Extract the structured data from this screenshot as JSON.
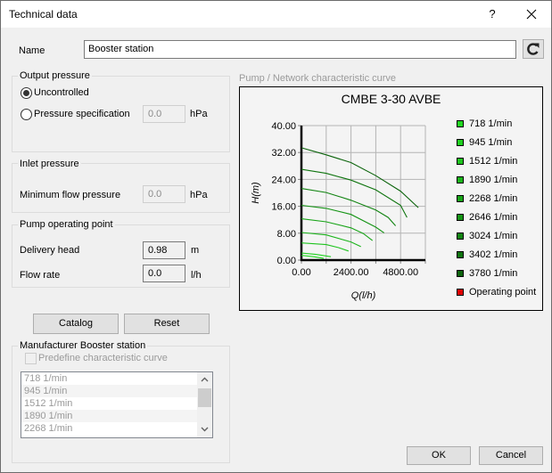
{
  "window": {
    "title": "Technical data",
    "help_label": "?",
    "close_label": "✕"
  },
  "name_field": {
    "label": "Name",
    "value": "Booster station",
    "refresh_icon": "refresh-icon"
  },
  "output_pressure": {
    "title": "Output pressure",
    "options": [
      {
        "label": "Uncontrolled",
        "checked": true
      },
      {
        "label": "Pressure specification",
        "checked": false
      }
    ],
    "pressure_value": "0.0",
    "pressure_unit": "hPa"
  },
  "inlet_pressure": {
    "title": "Inlet pressure",
    "min_flow_label": "Minimum flow pressure",
    "min_flow_value": "0.0",
    "min_flow_unit": "hPa"
  },
  "operating_point": {
    "title": "Pump operating point",
    "delivery_head_label": "Delivery head",
    "delivery_head_value": "0.98",
    "delivery_head_unit": "m",
    "flow_rate_label": "Flow rate",
    "flow_rate_value": "0.0",
    "flow_rate_unit": "l/h"
  },
  "buttons": {
    "catalog": "Catalog",
    "reset": "Reset",
    "ok": "OK",
    "cancel": "Cancel"
  },
  "manufacturer": {
    "title": "Manufacturer Booster station",
    "predefine_label": "Predefine characteristic curve",
    "predefine_checked": false,
    "list_items": [
      "718 1/min",
      "945 1/min",
      "1512 1/min",
      "1890 1/min",
      "2268 1/min"
    ],
    "scroll_up": "⌃",
    "scroll_down": "⌄"
  },
  "chart_caption": "Pump / Network characteristic curve",
  "chart_data": {
    "type": "line",
    "title": "CMBE 3-30 AVBE",
    "xlabel": "Q(l/h)",
    "ylabel": "H(m)",
    "xlim": [
      0,
      6000
    ],
    "ylim": [
      0,
      40
    ],
    "x_ticks": [
      0,
      1200,
      2400,
      3600,
      4800,
      6000
    ],
    "x_tick_labels": [
      "0.00",
      "",
      "2400.00",
      "",
      "4800.00",
      ""
    ],
    "y_ticks": [
      0,
      8,
      16,
      24,
      32,
      40
    ],
    "y_tick_labels": [
      "0.00",
      "8.00",
      "16.00",
      "24.00",
      "32.00",
      "40.00"
    ],
    "grid": true,
    "legend_position": "right",
    "series": [
      {
        "name": "718 1/min",
        "color": "#22d822",
        "points": [
          [
            0,
            1.4
          ],
          [
            600,
            1.0
          ],
          [
            1080,
            0.5
          ]
        ]
      },
      {
        "name": "945 1/min",
        "color": "#20d020",
        "points": [
          [
            0,
            2.1
          ],
          [
            700,
            1.7
          ],
          [
            1430,
            1.0
          ]
        ]
      },
      {
        "name": "1512 1/min",
        "color": "#1ec41e",
        "points": [
          [
            0,
            5.1
          ],
          [
            1200,
            4.6
          ],
          [
            1800,
            3.7
          ],
          [
            2280,
            2.7
          ]
        ]
      },
      {
        "name": "1890 1/min",
        "color": "#1bb41b",
        "points": [
          [
            0,
            8.2
          ],
          [
            1200,
            7.5
          ],
          [
            2400,
            5.4
          ],
          [
            2880,
            4.0
          ]
        ]
      },
      {
        "name": "2268 1/min",
        "color": "#18a418",
        "points": [
          [
            0,
            12.3
          ],
          [
            1200,
            11.4
          ],
          [
            2400,
            9.6
          ],
          [
            3000,
            7.9
          ],
          [
            3440,
            5.8
          ]
        ]
      },
      {
        "name": "2646 1/min",
        "color": "#159415",
        "points": [
          [
            0,
            16.3
          ],
          [
            1200,
            15.4
          ],
          [
            2400,
            13.6
          ],
          [
            3600,
            9.8
          ],
          [
            4000,
            8.1
          ]
        ]
      },
      {
        "name": "3024 1/min",
        "color": "#128412",
        "points": [
          [
            0,
            21.3
          ],
          [
            1200,
            20.1
          ],
          [
            2400,
            17.8
          ],
          [
            3600,
            14.9
          ],
          [
            4200,
            12.7
          ],
          [
            4560,
            10.2
          ]
        ]
      },
      {
        "name": "3402 1/min",
        "color": "#0f740f",
        "points": [
          [
            0,
            27.0
          ],
          [
            1200,
            25.8
          ],
          [
            2400,
            23.8
          ],
          [
            3600,
            20.9
          ],
          [
            4800,
            16.3
          ],
          [
            5110,
            12.7
          ]
        ]
      },
      {
        "name": "3780 1/min",
        "color": "#0c640c",
        "points": [
          [
            0,
            33.4
          ],
          [
            1200,
            31.3
          ],
          [
            2400,
            29.0
          ],
          [
            3600,
            25.1
          ],
          [
            4800,
            20.5
          ],
          [
            5660,
            15.6
          ]
        ]
      }
    ],
    "operating_point": {
      "name": "Operating point",
      "color": "#e00000",
      "q": 0.0,
      "h": 0.98
    }
  }
}
